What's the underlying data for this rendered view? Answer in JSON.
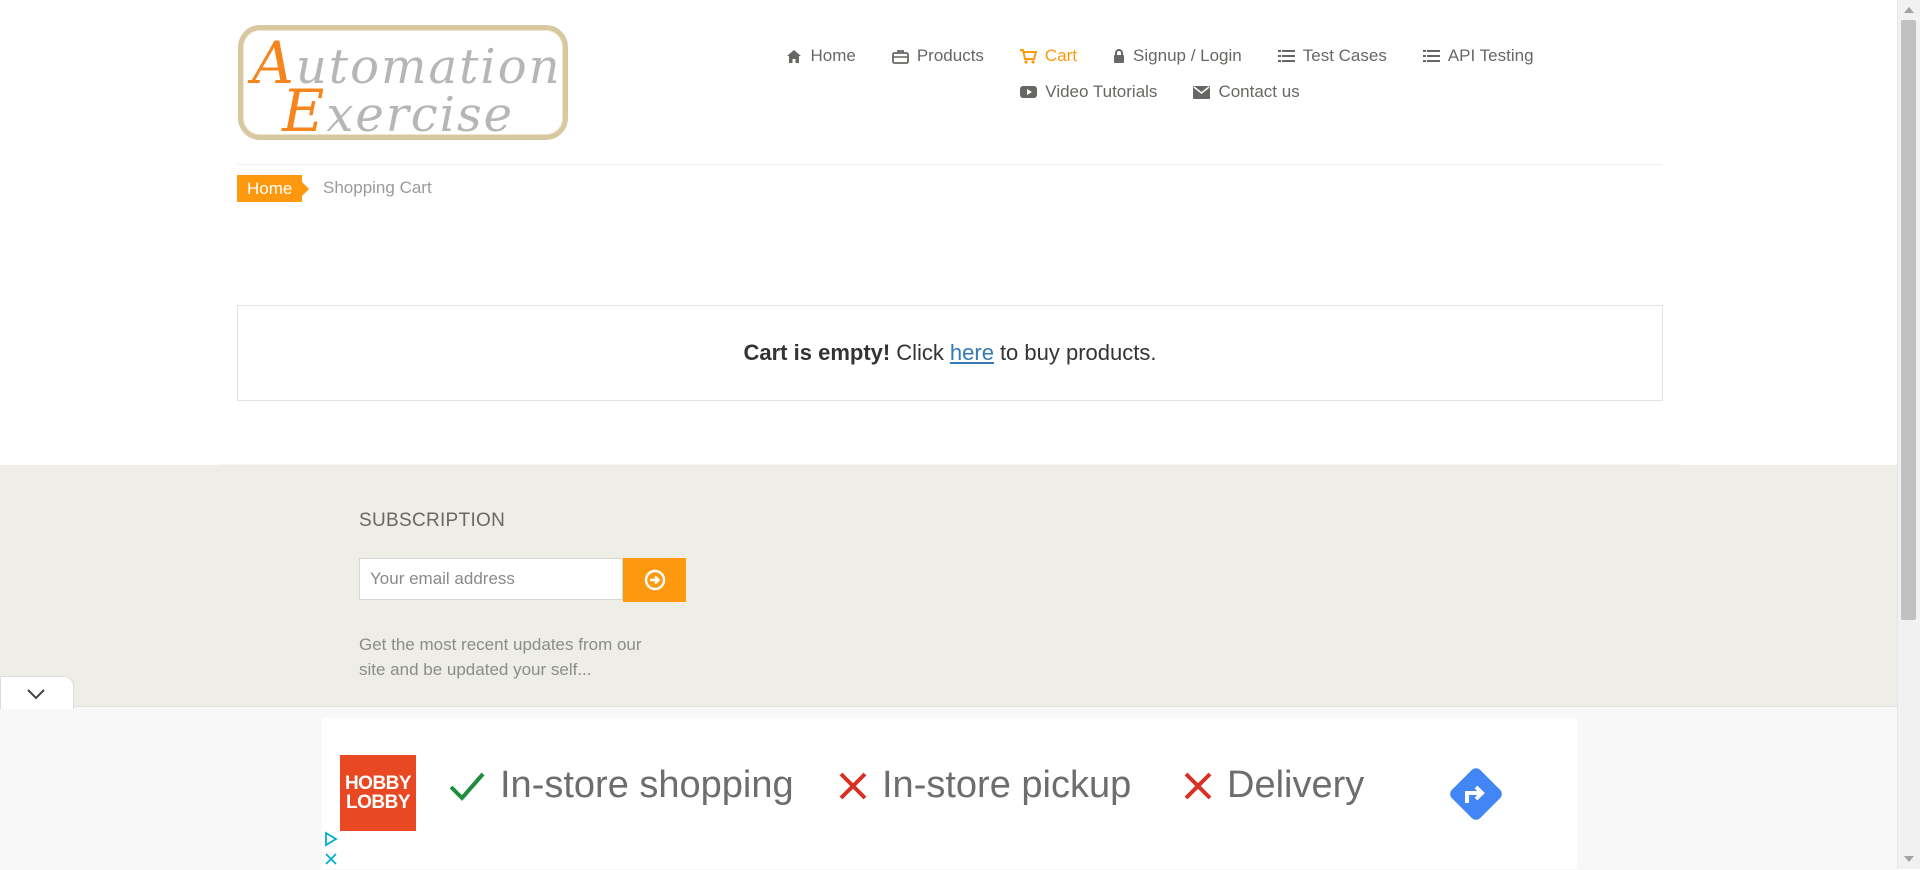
{
  "logo": {
    "line1_first": "A",
    "line1_rest": "utomation",
    "line2_first": "E",
    "line2_rest": "xercise"
  },
  "nav": [
    {
      "label": "Home",
      "icon": "home-icon"
    },
    {
      "label": "Products",
      "icon": "briefcase-icon"
    },
    {
      "label": "Cart",
      "icon": "shopping-cart-icon",
      "active": true
    },
    {
      "label": "Signup / Login",
      "icon": "lock-icon"
    },
    {
      "label": "Test Cases",
      "icon": "list-icon"
    },
    {
      "label": "API Testing",
      "icon": "list-icon"
    },
    {
      "label": "Video Tutorials",
      "icon": "youtube-play-icon"
    },
    {
      "label": "Contact us",
      "icon": "envelope-icon"
    }
  ],
  "breadcrumb": {
    "home": "Home",
    "current": "Shopping Cart"
  },
  "cart": {
    "empty_bold": "Cart is empty!",
    "click": "Click",
    "link": "here",
    "rest": "to buy products."
  },
  "footer": {
    "subscription_title": "SUBSCRIPTION",
    "email_placeholder": "Your email address",
    "description": "Get the most recent updates from our site and be updated your self..."
  },
  "ad": {
    "brand_line1": "HOBBY",
    "brand_line2": "LOBBY",
    "features": [
      {
        "label": "In-store shopping",
        "available": true
      },
      {
        "label": "In-store pickup",
        "available": false
      },
      {
        "label": "Delivery",
        "available": false
      }
    ]
  },
  "colors": {
    "accent": "#fe980f",
    "link": "#337ab7",
    "footer_bg": "#eeeee7",
    "ad_brand": "#e84922",
    "check": "#1e8e3e",
    "cross": "#d93025",
    "directions": "#4285f4"
  }
}
